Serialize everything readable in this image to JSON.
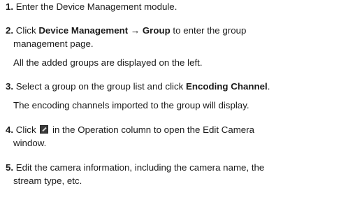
{
  "steps": [
    {
      "num": "1.",
      "parts": [
        "Enter the Device Management module."
      ]
    },
    {
      "num": "2.",
      "pre": "Click ",
      "bold": "Device Management → Group",
      "post": " to enter the group",
      "line2": "management page.",
      "note": "All the added groups are displayed on the left."
    },
    {
      "num": "3.",
      "pre": "Select a group on the group list and click ",
      "bold": "Encoding Channel",
      "post": ".",
      "note": "The encoding channels imported to the group will display."
    },
    {
      "num": "4.",
      "pre": "Click ",
      "icon": "edit-icon",
      "post": " in the Operation column to open the Edit Camera",
      "line2": "window."
    },
    {
      "num": "5.",
      "line1": "Edit the camera information, including the camera name, the",
      "line2": "stream type, etc."
    }
  ]
}
